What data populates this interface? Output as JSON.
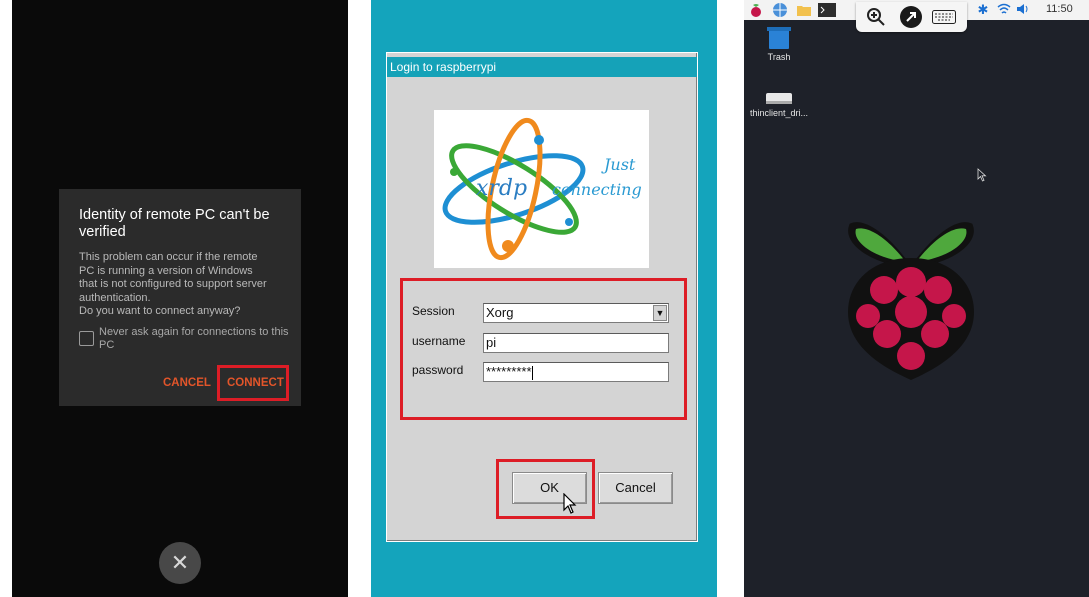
{
  "android_dialog": {
    "title": "Identity of remote PC can't be verified",
    "body_lines": [
      "This problem can occur if the remote",
      "PC is running a version of Windows",
      "that is not configured to support server",
      "authentication.",
      "Do you want to connect anyway?"
    ],
    "checkbox_label": "Never ask again for connections to this PC",
    "cancel_label": "CANCEL",
    "connect_label": "CONNECT",
    "close_glyph": "✕",
    "accent_color": "#e2552a"
  },
  "xrdp_login": {
    "window_title": "Login to raspberrypi",
    "logo": {
      "text": "xrdp",
      "tagline_1": "Just",
      "tagline_2": "connecting"
    },
    "session_label": "Session",
    "session_value": "Xorg",
    "username_label": "username",
    "username_value": "pi",
    "password_label": "password",
    "password_value": "*********",
    "ok_label": "OK",
    "cancel_label": "Cancel",
    "highlight_color": "#dd1d26"
  },
  "pi_desktop": {
    "clock": "11:50",
    "trash_label": "Trash",
    "drive_label": "thinclient_dri...",
    "icons": [
      "raspberry-menu-icon",
      "web-browser-icon",
      "folder-icon",
      "terminal-icon",
      "zoom-icon",
      "remote-icon",
      "keyboard-icon",
      "bluetooth-icon",
      "wifi-icon",
      "volume-icon"
    ]
  }
}
